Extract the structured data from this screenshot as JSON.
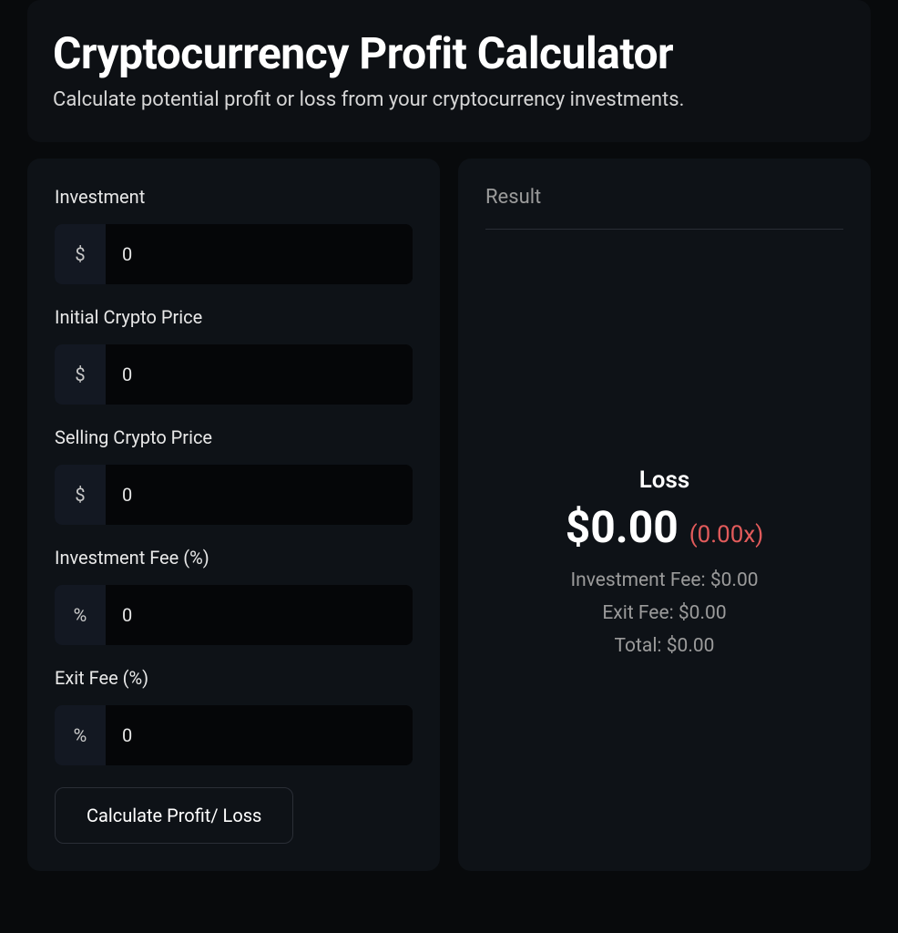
{
  "header": {
    "title": "Cryptocurrency Profit Calculator",
    "subtitle": "Calculate potential profit or loss from your cryptocurrency investments."
  },
  "form": {
    "investment": {
      "label": "Investment",
      "prefix": "$",
      "value": "0"
    },
    "initial_price": {
      "label": "Initial Crypto Price",
      "prefix": "$",
      "value": "0"
    },
    "selling_price": {
      "label": "Selling Crypto Price",
      "prefix": "$",
      "value": "0"
    },
    "investment_fee": {
      "label": "Investment Fee (%)",
      "prefix": "%",
      "value": "0"
    },
    "exit_fee": {
      "label": "Exit Fee (%)",
      "prefix": "%",
      "value": "0"
    },
    "calculate_button": "Calculate Profit/ Loss"
  },
  "result": {
    "title": "Result",
    "status": "Loss",
    "amount": "$0.00",
    "multiplier": "(0.00x)",
    "investment_fee_line": "Investment Fee: $0.00",
    "exit_fee_line": "Exit Fee: $0.00",
    "total_line": "Total: $0.00"
  }
}
